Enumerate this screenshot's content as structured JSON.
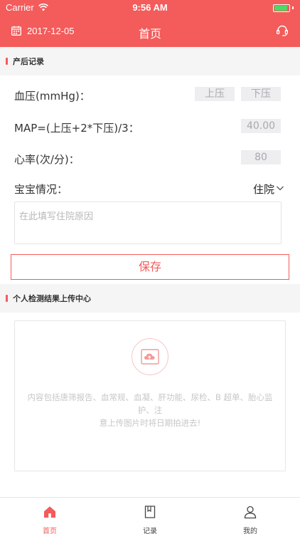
{
  "status_bar": {
    "carrier": "Carrier",
    "time": "9:56 AM"
  },
  "nav": {
    "date": "2017-12-05",
    "title": "首页",
    "calendar_icon": "calendar-icon",
    "support_icon": "headset-icon"
  },
  "postpartum": {
    "section_title": "产后记录",
    "blood_pressure_label": "血压(mmHg)：",
    "systolic_placeholder": "上压",
    "diastolic_placeholder": "下压",
    "map_label": "MAP=(上压+2*下压)/3：",
    "map_value": "40.00",
    "heart_rate_label": "心率(次/分)：",
    "heart_rate_value": "80",
    "baby_label": "宝宝情况：",
    "baby_status": "住院",
    "reason_placeholder": "在此填写住院原因",
    "save_label": "保存"
  },
  "upload": {
    "section_title": "个人检测结果上传中心",
    "description_line1": "内容包括唐筛报告、血常规、血凝、肝功能、尿检、B 超单、胎心监护、注",
    "description_line2": "意上传图片时将日期拍进去!"
  },
  "tabbar": {
    "items": [
      {
        "label": "首页",
        "icon": "home-icon",
        "active": true
      },
      {
        "label": "记录",
        "icon": "book-icon",
        "active": false
      },
      {
        "label": "我的",
        "icon": "person-icon",
        "active": false
      }
    ]
  },
  "colors": {
    "brand": "#f45b5b",
    "battery": "#4cd964"
  },
  "battery_level": 0.9
}
